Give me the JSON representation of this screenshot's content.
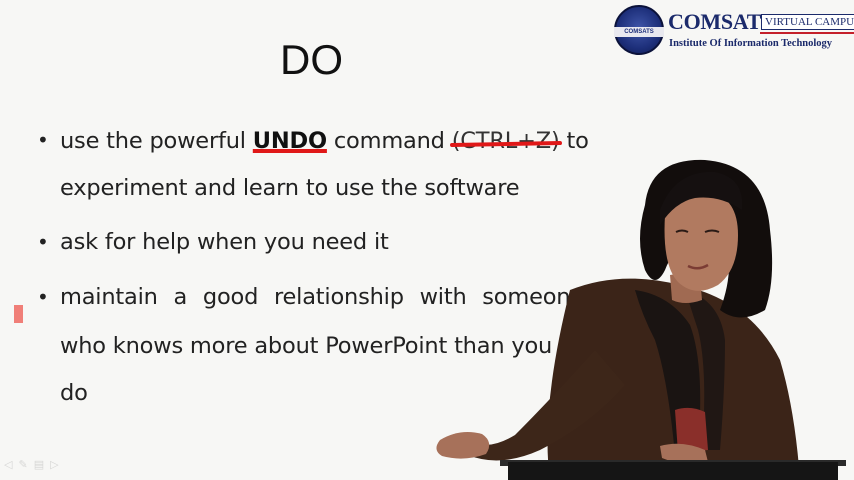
{
  "slide": {
    "title": "DO",
    "bullets": [
      {
        "pre": "use the powerful ",
        "emph": "UNDO",
        "mid": " command ",
        "struck": "(CTRL+Z)",
        "post": " to",
        "line2": "experiment and learn to use the software"
      },
      {
        "text": "ask for help when you need it"
      },
      {
        "line1_words": [
          "maintain",
          "a",
          "good",
          "relationship",
          "with",
          "someone"
        ],
        "line2": "who knows more about PowerPoint than you",
        "line3": "do"
      }
    ],
    "bullet_glyph": "•"
  },
  "logo": {
    "name": "COMSATS",
    "tag": "VIRTUAL CAMPUS",
    "subtitle": "Institute Of Information Technology",
    "seal_text": "COMSATS"
  },
  "colors": {
    "background": "#f7f7f5",
    "text": "#222222",
    "emphasis_red": "#e01818",
    "logo_blue": "#1b2a6b"
  }
}
